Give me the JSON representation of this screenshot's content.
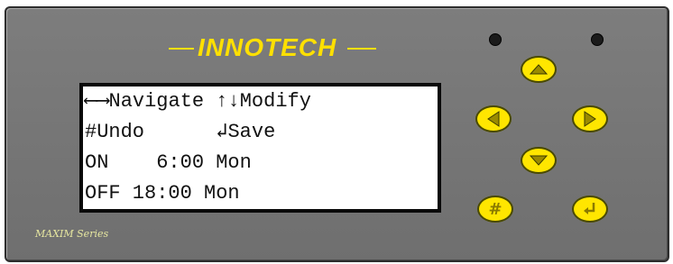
{
  "brand": {
    "name": "INNOTECH"
  },
  "series": "MAXIM Series",
  "lcd": {
    "row1": "⟵⟶Navigate ↑↓Modify",
    "row2": "#Undo      ↲Save",
    "row3": "ON    6:00 Mon",
    "row4": "OFF 18:00 Mon"
  },
  "buttons": {
    "up_icon": "up-arrow-icon",
    "left_icon": "left-arrow-icon",
    "right_icon": "right-arrow-icon",
    "down_icon": "down-arrow-icon",
    "hash_label": "#",
    "enter_icon": "enter-icon"
  },
  "colors": {
    "accent": "#ffe600",
    "panel": "#777777"
  }
}
